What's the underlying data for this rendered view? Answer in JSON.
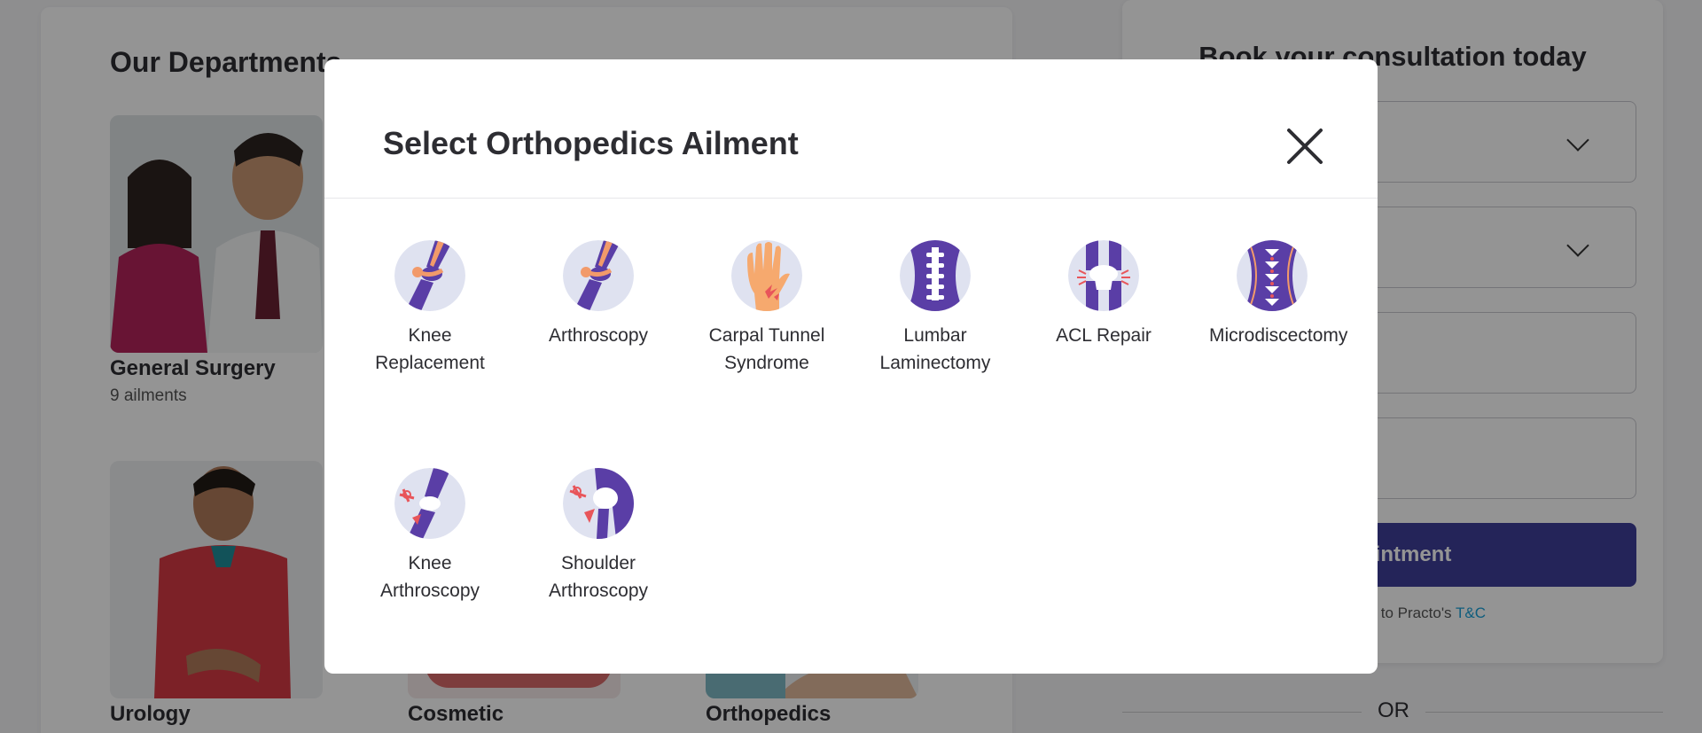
{
  "background": {
    "departments": {
      "heading": "Our Departments",
      "tiles": [
        {
          "name": "General Surgery",
          "count": "9 ailments"
        },
        {
          "name": "Urology"
        },
        {
          "name": "Cosmetic"
        },
        {
          "name": "Orthopedics"
        }
      ]
    },
    "booking": {
      "title": "Book your consultation today",
      "button_label": "ppointment",
      "terms_prefix": ", you agree to Practo's",
      "terms_link": "T&C",
      "or_text": "OR"
    }
  },
  "modal": {
    "title": "Select Orthopedics Ailment",
    "close_icon": "close-icon",
    "ailments": [
      {
        "label": "Knee Replacement",
        "icon": "knee-joint-icon"
      },
      {
        "label": "Arthroscopy",
        "icon": "knee-joint-icon"
      },
      {
        "label": "Carpal Tunnel Syndrome",
        "icon": "hand-pain-icon"
      },
      {
        "label": "Lumbar Laminectomy",
        "icon": "lumbar-spine-icon"
      },
      {
        "label": "ACL Repair",
        "icon": "acl-knee-icon"
      },
      {
        "label": "Microdiscectomy",
        "icon": "spine-disc-icon"
      },
      {
        "label": "Knee Arthroscopy",
        "icon": "knee-scope-icon"
      },
      {
        "label": "Shoulder Arthroscopy",
        "icon": "shoulder-scope-icon"
      }
    ]
  },
  "colors": {
    "icon_purple": "#5a3ea6",
    "icon_bg": "#dfe2f0",
    "icon_orange": "#f29a6a",
    "icon_red": "#e8555a",
    "accent_button": "#3e3f9a",
    "link": "#1aa0d8"
  }
}
